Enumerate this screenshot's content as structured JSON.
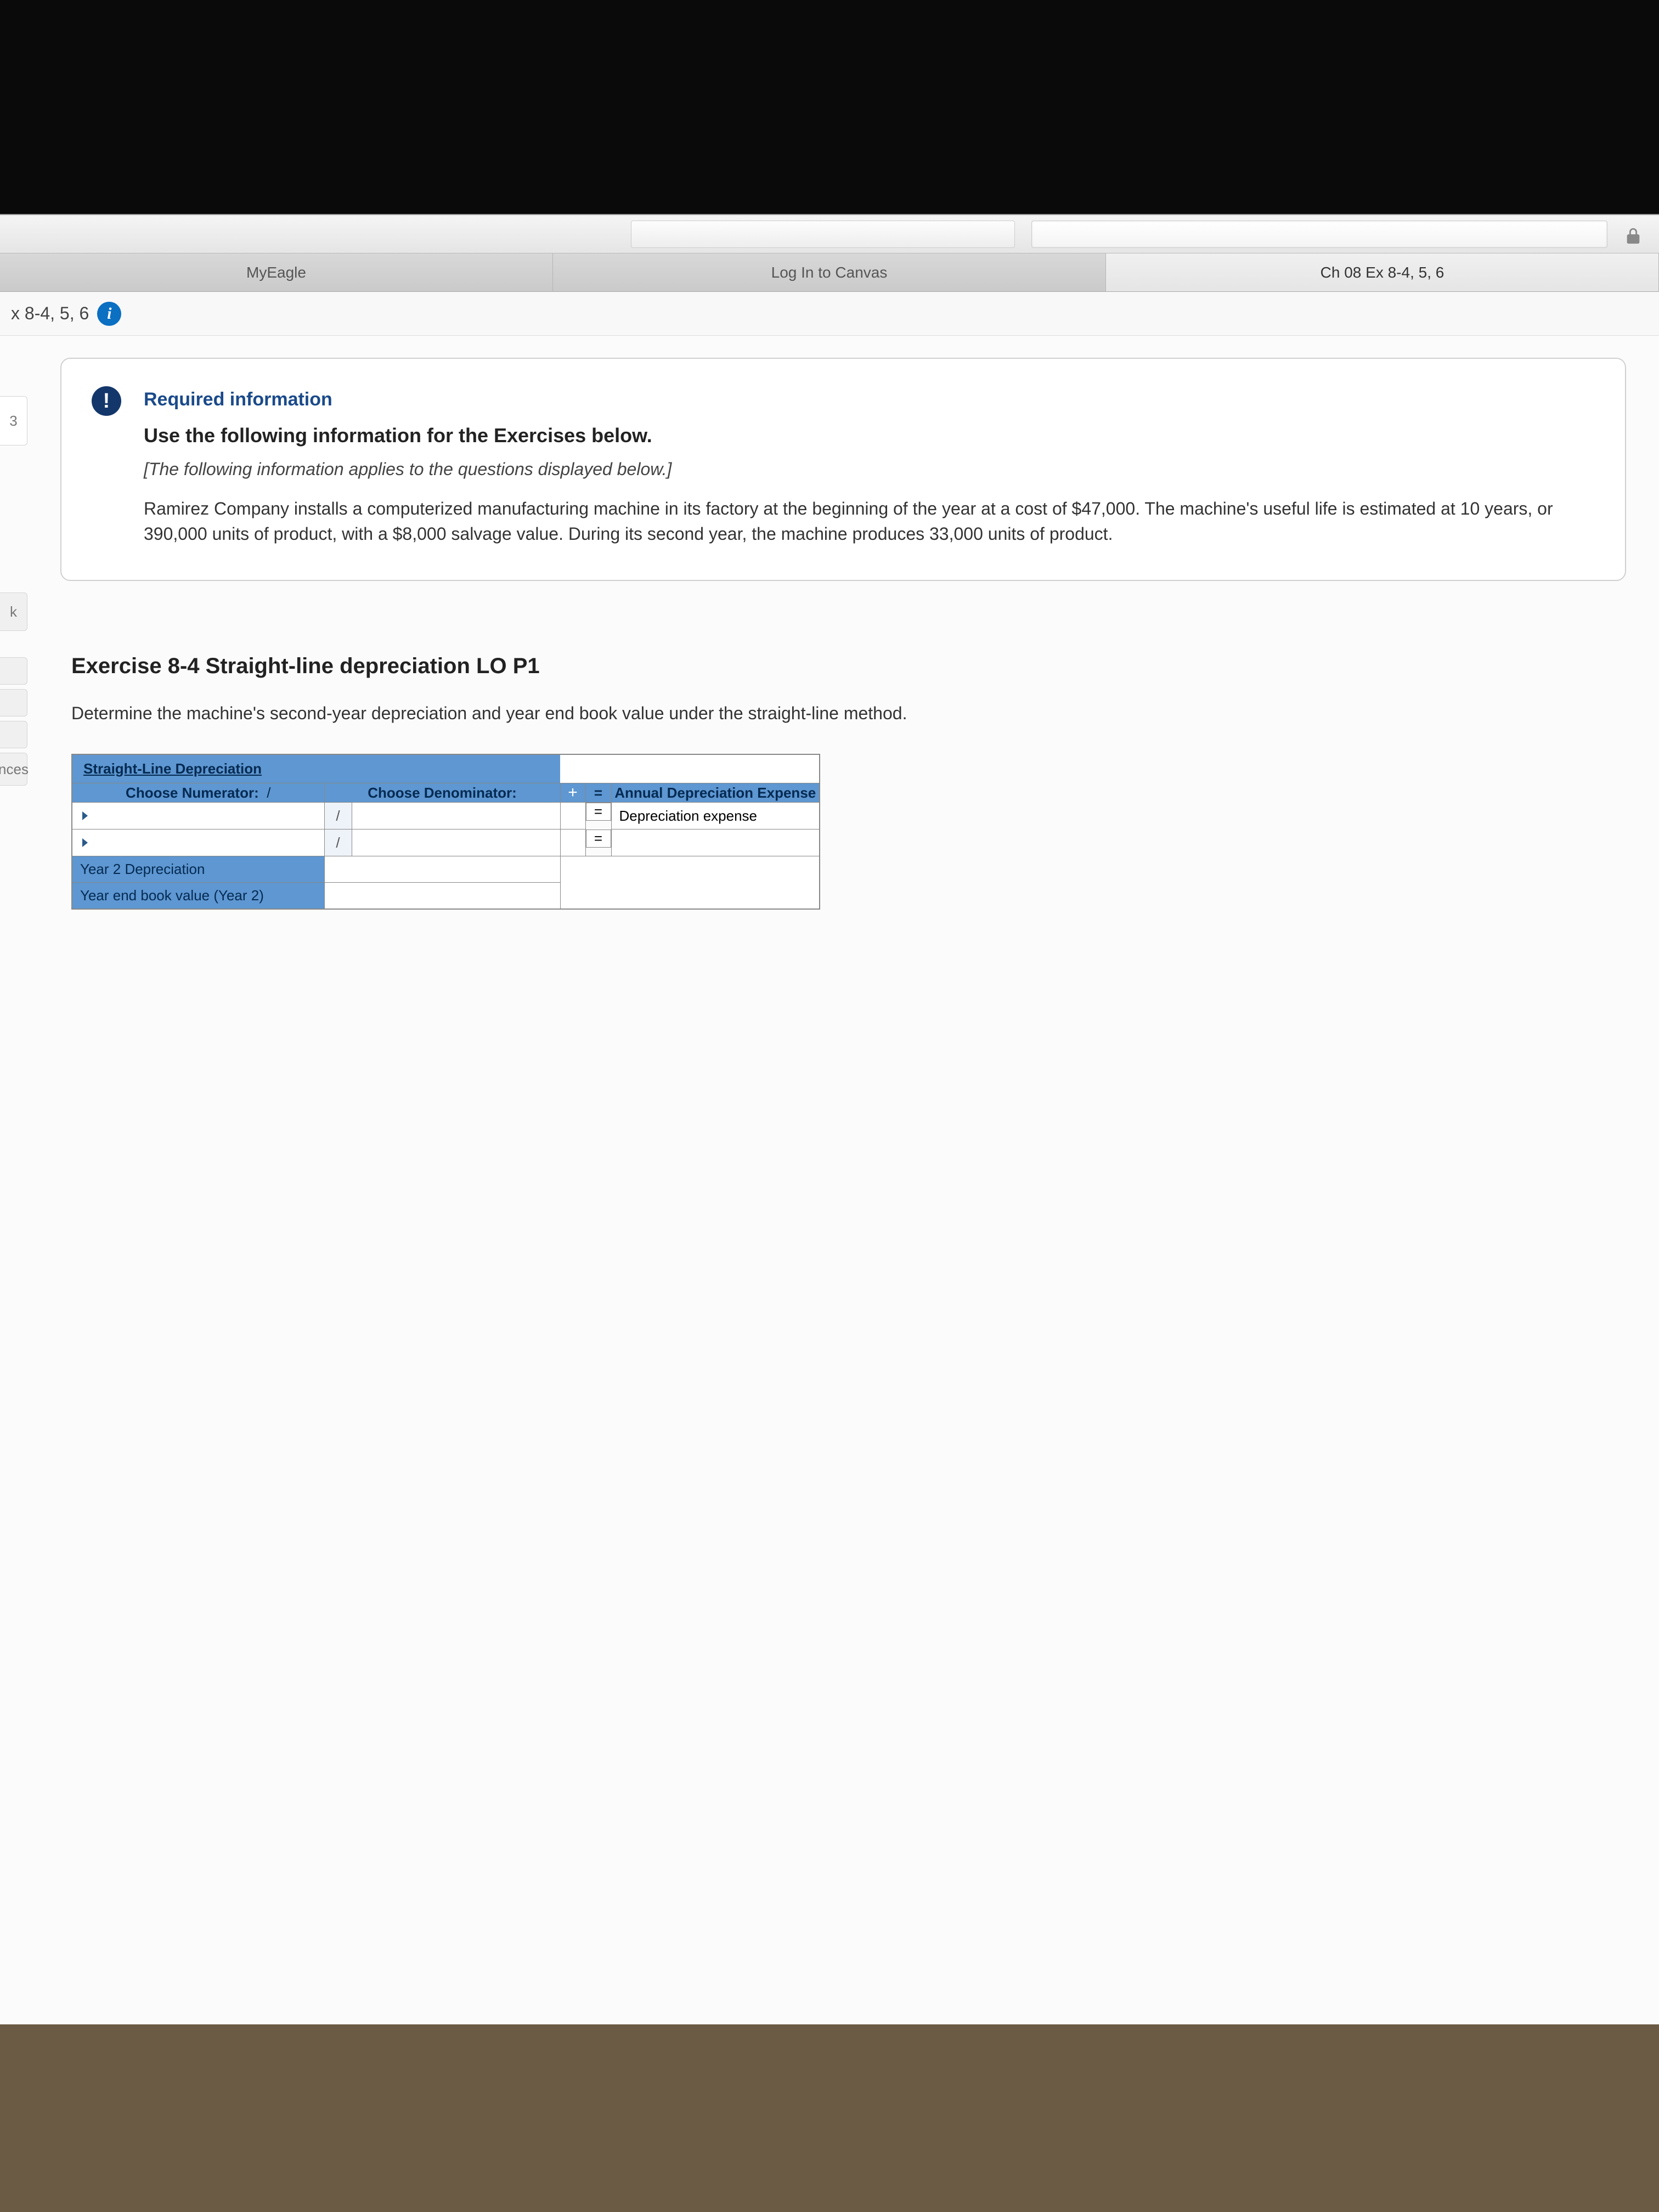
{
  "browser": {
    "tabs": [
      {
        "label": "MyEagle",
        "active": false
      },
      {
        "label": "Log In to Canvas",
        "active": false
      },
      {
        "label": "Ch 08 Ex 8-4, 5, 6",
        "active": true
      }
    ],
    "page_heading": "x 8-4, 5, 6"
  },
  "side": {
    "num": "3",
    "labels": [
      "k",
      "",
      "",
      "",
      "nces"
    ]
  },
  "required_info": {
    "heading": "Required information",
    "bold_line": "Use the following information for the Exercises below.",
    "italic_line": "[The following information applies to the questions displayed below.]",
    "body": "Ramirez Company installs a computerized manufacturing machine in its factory at the beginning of the year at a cost of $47,000. The machine's useful life is estimated at 10 years, or 390,000 units of product, with a $8,000 salvage value. During its second year, the machine produces 33,000 units of product."
  },
  "exercise": {
    "title": "Exercise 8-4 Straight-line depreciation LO P1",
    "instruction": "Determine the machine's second-year depreciation and year end book value under the straight-line method."
  },
  "table": {
    "tab_label": "Straight-Line Depreciation",
    "choose_numerator": "Choose Numerator:",
    "slash": "/",
    "choose_denominator": "Choose Denominator:",
    "plus": "+",
    "equals": "=",
    "annual_dep": "Annual Depreciation Expense",
    "dep_expense": "Depreciation expense",
    "year2_dep": "Year 2 Depreciation",
    "year_end_bv": "Year end book value (Year 2)"
  }
}
